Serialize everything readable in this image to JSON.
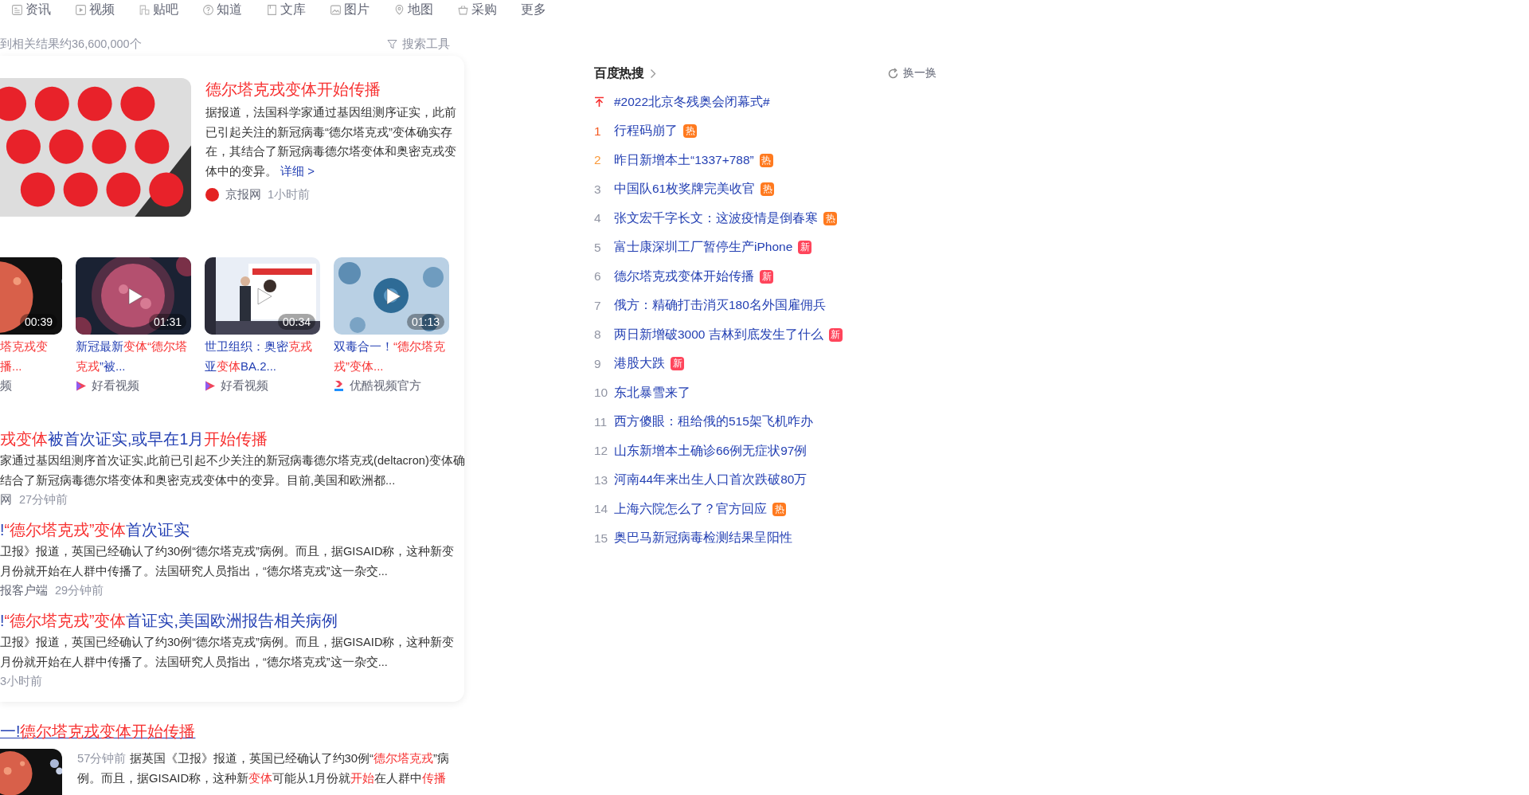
{
  "nav": [
    {
      "label": "资讯",
      "kind": "tab"
    },
    {
      "label": "视频",
      "kind": "tab"
    },
    {
      "label": "贴吧",
      "kind": "tab"
    },
    {
      "label": "知道",
      "kind": "tab"
    },
    {
      "label": "文库",
      "kind": "tab"
    },
    {
      "label": "图片",
      "kind": "tab"
    },
    {
      "label": "地图",
      "kind": "tab"
    },
    {
      "label": "采购",
      "kind": "tab"
    },
    {
      "label": "更多",
      "kind": "more"
    }
  ],
  "result_count": "到相关结果约36,600,000个",
  "search_tools": "搜索工具",
  "featured": {
    "title": "德尔塔克戎变体开始传播",
    "summary_lines": [
      "据报道，法国科学家通过基因组测序证实，此前",
      "已引起关注的新冠病毒“德尔塔克戎”变体确实存",
      "在，其结合了新冠病毒德尔塔变体和奥密克戎变",
      "体中的变异。"
    ],
    "more_link": "详细 >",
    "source": "京报网",
    "time": "1小时前"
  },
  "videos": [
    {
      "duration": "00:39",
      "title_lines": [
        [
          {
            "text": "塔克戎变",
            "highlighted": true
          }
        ],
        [
          {
            "text": "播...",
            "highlighted": true
          }
        ]
      ],
      "source": "频"
    },
    {
      "duration": "01:31",
      "title_lines": [
        [
          {
            "text": "新冠最新",
            "highlighted": false
          },
          {
            "text": "变体",
            "highlighted": true
          },
          {
            "text": "“德尔塔",
            "highlighted": true
          }
        ],
        [
          {
            "text": "克戎",
            "highlighted": true
          },
          {
            "text": "”被...",
            "highlighted": false
          }
        ]
      ],
      "source": "好看视频"
    },
    {
      "duration": "00:34",
      "title_lines": [
        [
          {
            "text": "世卫组织：奥密",
            "highlighted": false
          },
          {
            "text": "克戎",
            "highlighted": true
          }
        ],
        [
          {
            "text": "亚",
            "highlighted": false
          },
          {
            "text": "变体",
            "highlighted": true
          },
          {
            "text": "BA.2...",
            "highlighted": false
          }
        ]
      ],
      "source": "好看视频"
    },
    {
      "duration": "01:13",
      "title_lines": [
        [
          {
            "text": "双毒合一！",
            "highlighted": false
          },
          {
            "text": "“德尔塔克",
            "highlighted": true
          }
        ],
        [
          {
            "text": "戎”变体...",
            "highlighted": true
          }
        ]
      ],
      "source": "优酷视频官方"
    }
  ],
  "results": [
    {
      "title": [
        {
          "text": "戎变体",
          "highlighted": true
        },
        {
          "text": "被首次证实,或早在1月",
          "highlighted": false
        },
        {
          "text": "开始传播",
          "highlighted": true
        }
      ],
      "body_lines": [
        "家通过基因组测序首次证实,此前已引起不少关注的新冠病毒德尔塔克戎(deltacron)变体确",
        "结合了新冠病毒德尔塔变体和奥密克戎变体中的变异。目前,美国和欧洲都..."
      ],
      "source": "网",
      "time": "27分钟前"
    },
    {
      "title": [
        {
          "text": "!",
          "highlighted": false
        },
        {
          "text": "“德尔塔克戎”变体",
          "highlighted": true
        },
        {
          "text": "首次证实",
          "highlighted": false
        }
      ],
      "body_lines": [
        "卫报》报道，英国已经确认了约30例“德尔塔克戎”病例。而且，据GISAID称，这种新变",
        "月份就开始在人群中传播了。法国研究人员指出，“德尔塔克戎”这一杂交..."
      ],
      "source": "报客户端",
      "time": "29分钟前"
    },
    {
      "title": [
        {
          "text": "!",
          "highlighted": false
        },
        {
          "text": "“德尔塔克戎”变体",
          "highlighted": true
        },
        {
          "text": "首证实,美国欧洲报告相关病例",
          "highlighted": false
        }
      ],
      "body_lines": [
        "卫报》报道，英国已经确认了约30例“德尔塔克戎”病例。而且，据GISAID称，这种新变",
        "月份就开始在人群中传播了。法国研究人员指出，“德尔塔克戎”这一杂交..."
      ],
      "time": "3小时前"
    }
  ],
  "next_result": {
    "title": [
      {
        "text": "一!",
        "highlighted": false
      },
      {
        "text": "德尔塔克戎变体开始传播",
        "highlighted": true
      }
    ],
    "time": "57分钟前",
    "body_lines": [
      [
        {
          "text": "据英国《卫报》报道，英国已经确认了约30例“",
          "highlighted": false
        },
        {
          "text": "德尔塔克戎",
          "highlighted": true
        },
        {
          "text": "”病",
          "highlighted": false
        }
      ],
      [
        {
          "text": "例。而且，据GISAID称，这种新",
          "highlighted": false
        },
        {
          "text": "变体",
          "highlighted": true
        },
        {
          "text": "可能从1月份就",
          "highlighted": false
        },
        {
          "text": "开始",
          "highlighted": true
        },
        {
          "text": "在人群中",
          "highlighted": false
        },
        {
          "text": "传播",
          "highlighted": true
        }
      ]
    ]
  },
  "hot_search": {
    "title": "百度热搜",
    "refresh": "换一换",
    "items": [
      {
        "kind": "pinned",
        "color": "#f73131",
        "title": "#2022北京冬残奥会闭幕式#"
      },
      {
        "kind": "ranked",
        "rank": "1",
        "color": "#f5581f",
        "title": "行程码崩了",
        "badge": {
          "text": "热",
          "kind": "hot"
        }
      },
      {
        "kind": "ranked",
        "rank": "2",
        "color": "#fa9a3c",
        "title": "昨日新增本土“1337+788”",
        "badge": {
          "text": "热",
          "kind": "hot"
        }
      },
      {
        "kind": "ranked",
        "rank": "3",
        "color": "#9195a3",
        "title": "中国队61枚奖牌完美收官",
        "badge": {
          "text": "热",
          "kind": "hot"
        }
      },
      {
        "kind": "ranked",
        "rank": "4",
        "color": "#9195a3",
        "title": "张文宏千字长文：这波疫情是倒春寒",
        "badge": {
          "text": "热",
          "kind": "hot"
        }
      },
      {
        "kind": "ranked",
        "rank": "5",
        "color": "#9195a3",
        "title": "富士康深圳工厂暂停生产iPhone",
        "badge": {
          "text": "新",
          "kind": "new"
        }
      },
      {
        "kind": "ranked",
        "rank": "6",
        "color": "#9195a3",
        "title": "德尔塔克戎变体开始传播",
        "badge": {
          "text": "新",
          "kind": "new"
        }
      },
      {
        "kind": "ranked",
        "rank": "7",
        "color": "#9195a3",
        "title": "俄方：精确打击消灭180名外国雇佣兵"
      },
      {
        "kind": "ranked",
        "rank": "8",
        "color": "#9195a3",
        "title": "两日新增破3000 吉林到底发生了什么",
        "badge": {
          "text": "新",
          "kind": "new"
        }
      },
      {
        "kind": "ranked",
        "rank": "9",
        "color": "#9195a3",
        "title": "港股大跌",
        "badge": {
          "text": "新",
          "kind": "new"
        }
      },
      {
        "kind": "ranked",
        "rank": "10",
        "color": "#9195a3",
        "title": "东北暴雪来了"
      },
      {
        "kind": "ranked",
        "rank": "11",
        "color": "#9195a3",
        "title": "西方傻眼：租给俄的515架飞机咋办"
      },
      {
        "kind": "ranked",
        "rank": "12",
        "color": "#9195a3",
        "title": "山东新增本土确诊66例无症状97例"
      },
      {
        "kind": "ranked",
        "rank": "13",
        "color": "#9195a3",
        "title": "河南44年来出生人口首次跌破80万"
      },
      {
        "kind": "ranked",
        "rank": "14",
        "color": "#9195a3",
        "title": "上海六院怎么了？官方回应",
        "badge": {
          "text": "热",
          "kind": "hot"
        }
      },
      {
        "kind": "ranked",
        "rank": "15",
        "color": "#9195a3",
        "title": "奥巴马新冠病毒检测结果呈阳性"
      }
    ]
  }
}
